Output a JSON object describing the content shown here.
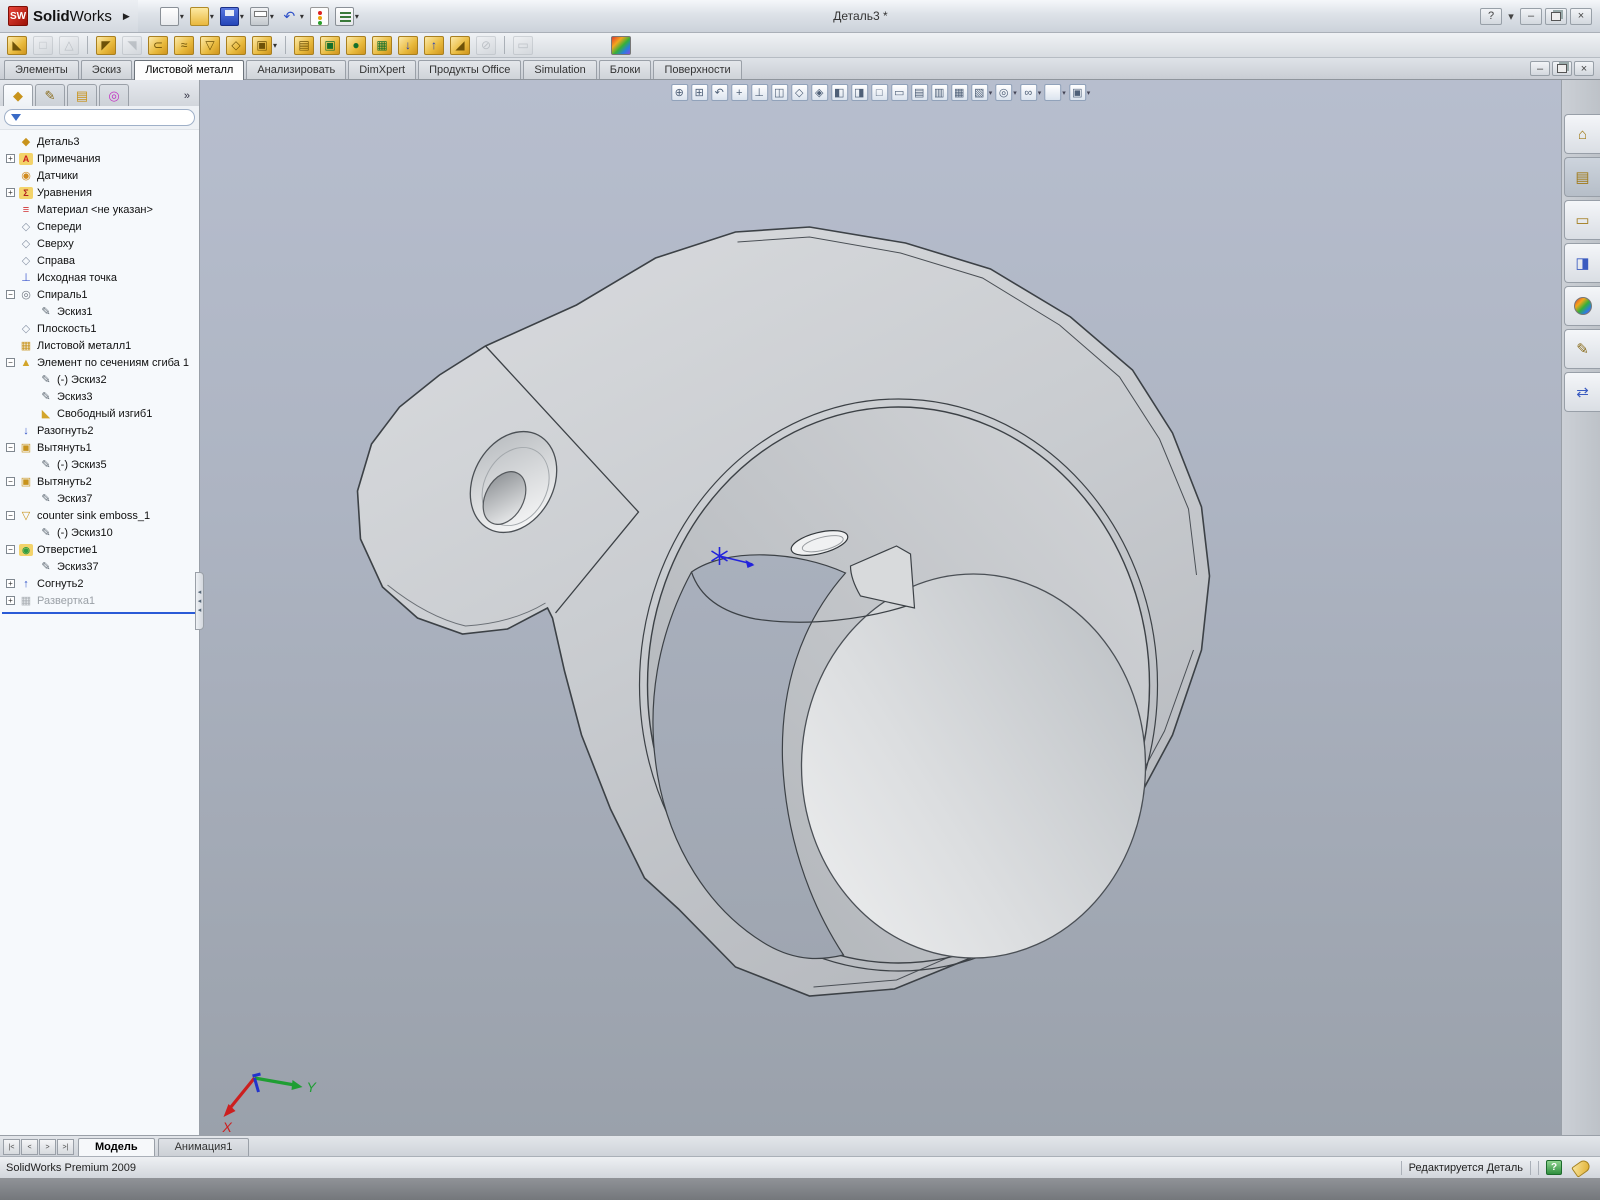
{
  "window": {
    "title": "Деталь3 *",
    "brand": {
      "logo": "SW",
      "bold": "Solid",
      "rest": "Works",
      "arrow": "▶"
    },
    "controls": {
      "help": "?",
      "help_caret": "▾",
      "minimize": "–",
      "close": "×"
    }
  },
  "glyphs": {
    "caret": "▾",
    "chevron": "»",
    "splitter": "◂\n◂\n◂"
  },
  "toolbar_main": {
    "items": [
      {
        "name": "new-document",
        "css": "doc",
        "caret": true
      },
      {
        "name": "open-document",
        "css": "folder",
        "caret": true
      },
      {
        "name": "save-document",
        "css": "floppy",
        "caret": true
      },
      {
        "name": "print-document",
        "css": "printer",
        "caret": true
      },
      {
        "name": "undo",
        "g": "↶",
        "c": "#2d50c8",
        "caret": true
      },
      {
        "name": "rebuild",
        "css": "stoplight"
      },
      {
        "name": "options",
        "css": "options",
        "caret": true
      }
    ]
  },
  "toolbar_sheetmetal": {
    "items": [
      {
        "name": "base-flange",
        "g": "◣",
        "tone": "gold"
      },
      {
        "name": "convert-to-sheet-metal",
        "g": "□",
        "tone": "gray",
        "dis": true
      },
      {
        "name": "lofted-bend",
        "g": "△",
        "tone": "gray",
        "dis": true
      },
      {
        "sep": true
      },
      {
        "name": "edge-flange",
        "g": "◤",
        "tone": "gold"
      },
      {
        "name": "miter-flange",
        "g": "◥",
        "tone": "gray",
        "dis": true
      },
      {
        "name": "hem",
        "g": "⊂",
        "tone": "gold"
      },
      {
        "name": "jog",
        "g": "≈",
        "tone": "gold"
      },
      {
        "name": "sketched-bend",
        "g": "▽",
        "tone": "gold"
      },
      {
        "name": "cross-break",
        "g": "◇",
        "tone": "gold"
      },
      {
        "name": "corners",
        "g": "▣",
        "tone": "gold",
        "caret": true
      },
      {
        "sep": true
      },
      {
        "name": "forming-tool",
        "g": "▤",
        "tone": "gold"
      },
      {
        "name": "extruded-cut",
        "g": "▣",
        "tone": "goldgreen"
      },
      {
        "name": "simple-hole",
        "g": "●",
        "tone": "goldgreen"
      },
      {
        "name": "vent",
        "g": "▦",
        "tone": "goldgreen"
      },
      {
        "name": "unfold",
        "g": "↓",
        "tone": "goldblue"
      },
      {
        "name": "fold",
        "g": "↑",
        "tone": "goldblue"
      },
      {
        "name": "break-corner",
        "g": "◢",
        "tone": "gold"
      },
      {
        "name": "no-bends",
        "g": "⊘",
        "tone": "gray",
        "dis": true
      },
      {
        "sep": true
      },
      {
        "name": "flatten",
        "g": "▭",
        "tone": "gray",
        "dis": true
      },
      {
        "gap": true
      },
      {
        "name": "appearance-colors",
        "g": "",
        "tone": "rainbow"
      }
    ]
  },
  "ribbon": {
    "tabs": [
      {
        "id": "features",
        "label": "Элементы"
      },
      {
        "id": "sketch",
        "label": "Эскиз"
      },
      {
        "id": "sheet-metal",
        "label": "Листовой металл",
        "active": true
      },
      {
        "id": "evaluate",
        "label": "Анализировать"
      },
      {
        "id": "dimxpert",
        "label": "DimXpert"
      },
      {
        "id": "office-products",
        "label": "Продукты Office"
      },
      {
        "id": "simulation",
        "label": "Simulation"
      },
      {
        "id": "blocks",
        "label": "Блоки"
      },
      {
        "id": "surfaces",
        "label": "Поверхности"
      }
    ]
  },
  "feature_panel": {
    "tabs": [
      {
        "name": "featuremanager",
        "g": "◆",
        "c": "#c8931c",
        "active": true
      },
      {
        "name": "propertymanager",
        "g": "✎",
        "c": "#8a6d1f"
      },
      {
        "name": "configurationmanager",
        "g": "▤",
        "c": "#c8931c"
      },
      {
        "name": "dimxpertmanager",
        "g": "◎",
        "c": "#c335c3"
      }
    ],
    "filter": {
      "value": "",
      "placeholder": ""
    }
  },
  "tree_icons": {
    "part": {
      "g": "◆",
      "c": "#c8931c"
    },
    "annotations": {
      "g": "A",
      "c": "#cc2222",
      "bg": "#f3d36a"
    },
    "sensors": {
      "g": "◉",
      "c": "#d08a1f"
    },
    "equations": {
      "g": "Σ",
      "c": "#b02020",
      "bg": "#f3d36a"
    },
    "material": {
      "g": "≡",
      "c": "#d03030"
    },
    "plane": {
      "g": "◇",
      "c": "#8b96a8"
    },
    "origin": {
      "g": "⊥",
      "c": "#3a55cc"
    },
    "helix": {
      "g": "◎",
      "c": "#6f7680"
    },
    "sketch": {
      "g": "✎",
      "c": "#5b6670"
    },
    "sheetmetal": {
      "g": "▦",
      "c": "#c8931c"
    },
    "loftedbend": {
      "g": "▲",
      "c": "#d3a52a"
    },
    "freebend": {
      "g": "◣",
      "c": "#d3a52a"
    },
    "unfold": {
      "g": "↓",
      "c": "#2d50c8"
    },
    "fold": {
      "g": "↑",
      "c": "#2d50c8"
    },
    "extrude": {
      "g": "▣",
      "c": "#c8931c"
    },
    "emboss": {
      "g": "▽",
      "c": "#c8931c"
    },
    "hole": {
      "g": "◉",
      "c": "#2f9e44",
      "bg": "#f3d36a"
    },
    "flatpattern": {
      "g": "▦",
      "c": "#9aa0a6"
    }
  },
  "tree": {
    "items": [
      {
        "label": "Деталь3",
        "icon": "part",
        "depth": 0,
        "exp": null
      },
      {
        "label": "Примечания",
        "icon": "annotations",
        "depth": 0,
        "exp": "+"
      },
      {
        "label": "Датчики",
        "icon": "sensors",
        "depth": 0,
        "exp": null
      },
      {
        "label": "Уравнения",
        "icon": "equations",
        "depth": 0,
        "exp": "+"
      },
      {
        "label": "Материал <не указан>",
        "icon": "material",
        "depth": 0,
        "exp": null
      },
      {
        "label": "Спереди",
        "icon": "plane",
        "depth": 0,
        "exp": null
      },
      {
        "label": "Сверху",
        "icon": "plane",
        "depth": 0,
        "exp": null
      },
      {
        "label": "Справа",
        "icon": "plane",
        "depth": 0,
        "exp": null
      },
      {
        "label": "Исходная точка",
        "icon": "origin",
        "depth": 0,
        "exp": null
      },
      {
        "label": "Спираль1",
        "icon": "helix",
        "depth": 0,
        "exp": "-"
      },
      {
        "label": "Эскиз1",
        "icon": "sketch",
        "depth": 1,
        "exp": null
      },
      {
        "label": "Плоскость1",
        "icon": "plane",
        "depth": 0,
        "exp": null
      },
      {
        "label": "Листовой металл1",
        "icon": "sheetmetal",
        "depth": 0,
        "exp": null
      },
      {
        "label": "Элемент по сечениям сгиба 1",
        "icon": "loftedbend",
        "depth": 0,
        "exp": "-"
      },
      {
        "label": "(-) Эскиз2",
        "icon": "sketch",
        "depth": 1,
        "exp": null
      },
      {
        "label": "Эскиз3",
        "icon": "sketch",
        "depth": 1,
        "exp": null
      },
      {
        "label": "Свободный изгиб1",
        "icon": "freebend",
        "depth": 1,
        "exp": null
      },
      {
        "label": "Разогнуть2",
        "icon": "unfold",
        "depth": 0,
        "exp": null
      },
      {
        "label": "Вытянуть1",
        "icon": "extrude",
        "depth": 0,
        "exp": "-"
      },
      {
        "label": "(-) Эскиз5",
        "icon": "sketch",
        "depth": 1,
        "exp": null
      },
      {
        "label": "Вытянуть2",
        "icon": "extrude",
        "depth": 0,
        "exp": "-"
      },
      {
        "label": "Эскиз7",
        "icon": "sketch",
        "depth": 1,
        "exp": null
      },
      {
        "label": "counter sink emboss_1",
        "icon": "emboss",
        "depth": 0,
        "exp": "-"
      },
      {
        "label": "(-) Эскиз10",
        "icon": "sketch",
        "depth": 1,
        "exp": null
      },
      {
        "label": "Отверстие1",
        "icon": "hole",
        "depth": 0,
        "exp": "-"
      },
      {
        "label": "Эскиз37",
        "icon": "sketch",
        "depth": 1,
        "exp": null
      },
      {
        "label": "Согнуть2",
        "icon": "fold",
        "depth": 0,
        "exp": "+"
      },
      {
        "label": "Развертка1",
        "icon": "flatpattern",
        "depth": 0,
        "exp": "+",
        "gray": true
      }
    ]
  },
  "headsup": {
    "items": [
      {
        "name": "zoom-to-fit",
        "g": "⊕"
      },
      {
        "name": "zoom-to-area",
        "g": "⊞"
      },
      {
        "name": "previous-view",
        "g": "↶"
      },
      {
        "name": "pan",
        "g": "+"
      },
      {
        "name": "normal-to",
        "g": "⊥"
      },
      {
        "name": "section-view",
        "g": "◫"
      },
      {
        "name": "view-front",
        "g": "◇"
      },
      {
        "name": "view-back",
        "g": "◈"
      },
      {
        "name": "view-left",
        "g": "◧"
      },
      {
        "name": "view-right",
        "g": "◨"
      },
      {
        "name": "view-isometric",
        "g": "□"
      },
      {
        "name": "viewport-single",
        "g": "▭"
      },
      {
        "name": "viewport-two-horizontal",
        "g": "▤"
      },
      {
        "name": "viewport-two-vertical",
        "g": "▥"
      },
      {
        "name": "viewport-four",
        "g": "▦"
      },
      {
        "name": "display-style",
        "g": "▧",
        "caret": true
      },
      {
        "name": "hide-show-items",
        "g": "◎",
        "caret": true
      },
      {
        "name": "view-settings",
        "g": "∞",
        "caret": true
      },
      {
        "name": "edit-appearance",
        "g": "",
        "tone": "rainbow",
        "caret": true
      },
      {
        "name": "apply-scene",
        "g": "▣",
        "caret": true
      }
    ]
  },
  "taskpane": {
    "items": [
      {
        "name": "solidworks-resources",
        "g": "⌂",
        "c": "#a07a18"
      },
      {
        "name": "design-library",
        "g": "▤",
        "c": "#a07a18",
        "active": true
      },
      {
        "name": "file-explorer",
        "g": "▭",
        "c": "#a07a18"
      },
      {
        "name": "view-palette",
        "g": "◨",
        "c": "#3a5bc0"
      },
      {
        "name": "appearances-scenes",
        "g": "",
        "tone": "rainbow"
      },
      {
        "name": "custom-properties",
        "g": "✎",
        "c": "#8a6d1f"
      },
      {
        "name": "document-recovery",
        "g": "⇄",
        "c": "#3a5bc0"
      }
    ]
  },
  "viewport": {
    "axis": {
      "x": "X",
      "y": "Y"
    }
  },
  "bottom": {
    "nav": [
      "|<",
      "<",
      ">",
      ">|"
    ],
    "tabs": [
      {
        "label": "Модель",
        "active": true
      },
      {
        "label": "Анимация1"
      }
    ]
  },
  "statusbar": {
    "left": "SolidWorks Premium 2009",
    "edit_state": "Редактируется Деталь",
    "help": "?"
  },
  "colors": {
    "gold": "#e0b23a",
    "disabled_gray": "#c4c8cd",
    "blue": "#2d50c8",
    "green": "#2f9e44",
    "viewport_top": "#b7bece",
    "viewport_bottom": "#9aa1ab",
    "rollback_blue": "#2a5bd7",
    "brand_red": "#e03a2f"
  }
}
